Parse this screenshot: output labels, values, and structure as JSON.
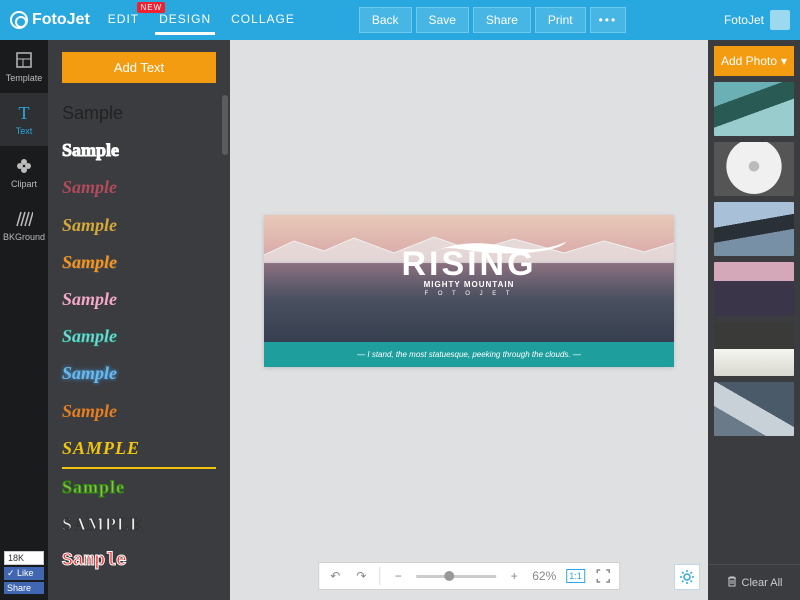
{
  "header": {
    "brand": "FotoJet",
    "modes": [
      {
        "label": "EDIT",
        "badge": "NEW"
      },
      {
        "label": "DESIGN"
      },
      {
        "label": "COLLAGE"
      }
    ],
    "active_mode": 1,
    "actions": {
      "back": "Back",
      "save": "Save",
      "share": "Share",
      "print": "Print",
      "more": "•••"
    },
    "username": "FotoJet"
  },
  "rail": [
    {
      "id": "template",
      "label": "Template"
    },
    {
      "id": "text",
      "label": "Text"
    },
    {
      "id": "clipart",
      "label": "Clipart"
    },
    {
      "id": "bkground",
      "label": "BKGround"
    }
  ],
  "rail_active": 1,
  "social": {
    "count": "18K",
    "like": "Like",
    "share": "Share"
  },
  "panel": {
    "add_text": "Add Text",
    "samples": [
      "Sample",
      "Sample",
      "Sample",
      "Sample",
      "Sample",
      "Sample",
      "Sample",
      "Sample",
      "Sample",
      "SAMPLE",
      "Sample",
      "SAMPLE",
      "Sample"
    ]
  },
  "canvas": {
    "title": "RISING",
    "subtitle": "MIGHTY MOUNTAIN",
    "subtitle2": "F O T O J E T",
    "quote": "I stand, the most statuesque, peeking through the clouds."
  },
  "toolbar": {
    "zoom": "62%",
    "ratio": "1:1"
  },
  "right": {
    "add_photo": "Add Photo",
    "clear_all": "Clear All"
  }
}
